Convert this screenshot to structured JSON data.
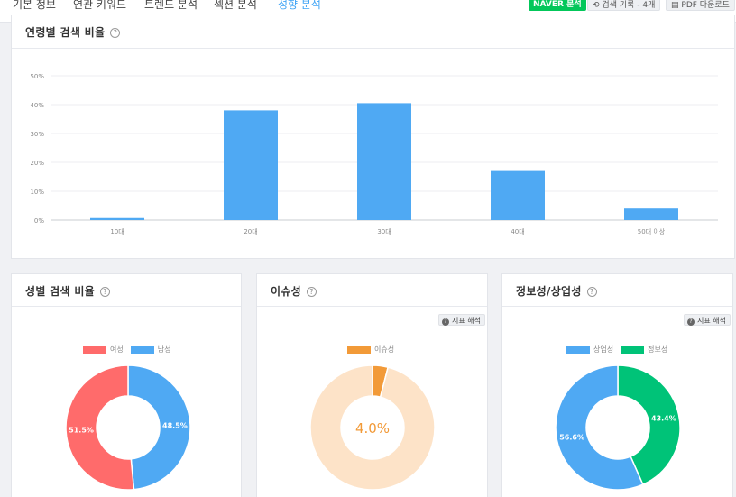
{
  "nav": {
    "tabs": [
      {
        "label": "기본 정보"
      },
      {
        "label": "연관 키워드"
      },
      {
        "label": "트렌드 분석"
      },
      {
        "label": "섹션 분석"
      },
      {
        "label": "성향 분석"
      }
    ],
    "naver_label": "NAVER 분석",
    "history_label": "검색 기록 - 4개",
    "pdf_label": "PDF 다운로드"
  },
  "age_card": {
    "title": "연령별 검색 비율",
    "help": "?"
  },
  "gender_card": {
    "title": "성별 검색 비율",
    "help": "?"
  },
  "issue_card": {
    "title": "이슈성",
    "help": "?",
    "interp_label": "지표 해석",
    "center_value": "4.0%"
  },
  "info_card": {
    "title": "정보성/상업성",
    "help": "?",
    "interp_label": "지표 해석"
  },
  "colors": {
    "blue": "#4fa9f3",
    "red": "#ff6b6b",
    "orange": "#f29a38",
    "peach": "#fde3c8",
    "green": "#00c378"
  },
  "chart_data": [
    {
      "type": "bar",
      "categories": [
        "10대",
        "20대",
        "30대",
        "40대",
        "50대 이상"
      ],
      "values": [
        0.7,
        38.0,
        40.5,
        17.0,
        4.0
      ],
      "ylim": [
        0,
        50
      ],
      "ytick_labels": [
        "0%",
        "10%",
        "20%",
        "30%",
        "40%",
        "50%"
      ],
      "grid": true
    },
    {
      "type": "pie",
      "series": [
        {
          "name": "여성",
          "value": 51.5,
          "label": "51.5%"
        },
        {
          "name": "남성",
          "value": 48.5,
          "label": "48.5%"
        }
      ],
      "legend": "top"
    },
    {
      "type": "pie",
      "series": [
        {
          "name": "이슈성",
          "value": 4.0
        }
      ],
      "legend": "top"
    },
    {
      "type": "pie",
      "series": [
        {
          "name": "상업성",
          "value": 56.6,
          "label": "56.6%"
        },
        {
          "name": "정보성",
          "value": 43.4,
          "label": "43.4%"
        }
      ],
      "legend": "top"
    }
  ]
}
